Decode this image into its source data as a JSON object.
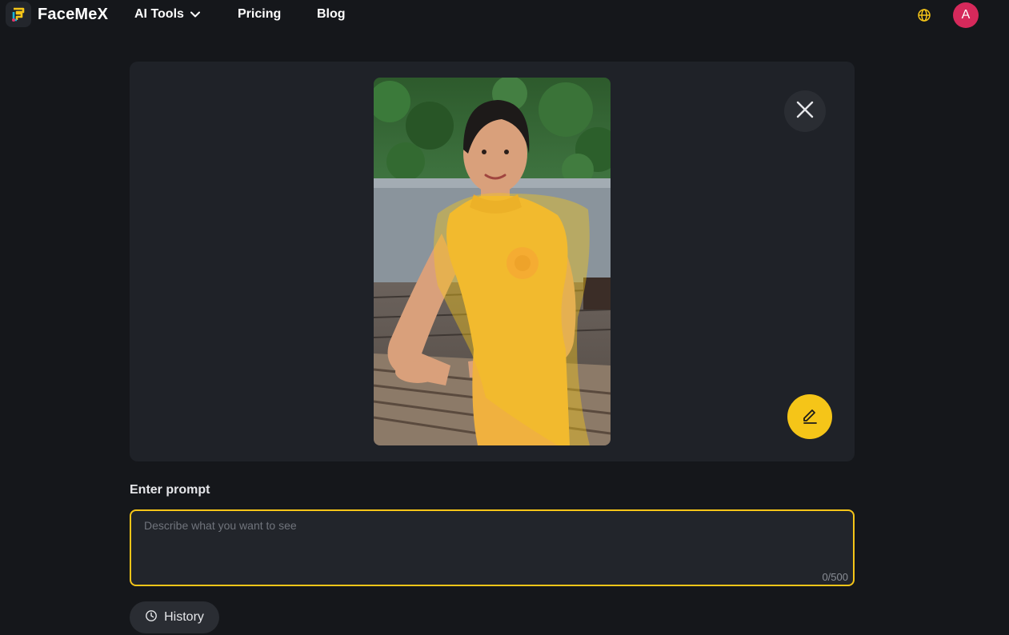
{
  "brand": {
    "name": "FaceMeX"
  },
  "nav": {
    "items": [
      {
        "label": "AI Tools",
        "has_dropdown": true
      },
      {
        "label": "Pricing"
      },
      {
        "label": "Blog"
      }
    ]
  },
  "header": {
    "language_icon": "globe-icon",
    "avatar_initial": "A"
  },
  "editor": {
    "image_alt": "Woman in yellow top seated at wooden bench with mask overlay",
    "close_icon": "close-icon",
    "edit_icon": "pencil-icon"
  },
  "prompt": {
    "label": "Enter prompt",
    "placeholder": "Describe what you want to see",
    "value": "",
    "counter": "0/500"
  },
  "history": {
    "label": "History",
    "icon": "clock-icon"
  },
  "colors": {
    "background": "#15171b",
    "panel": "#1f2228",
    "accent": "#f5c518",
    "avatar": "#d6295b"
  }
}
